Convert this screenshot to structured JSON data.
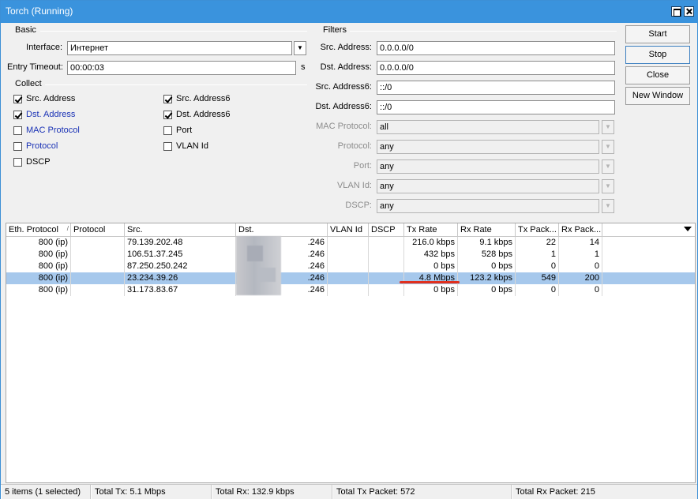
{
  "window": {
    "title": "Torch (Running)"
  },
  "basic": {
    "section": "Basic",
    "interface_label": "Interface:",
    "interface_value": "Интернет",
    "timeout_label": "Entry Timeout:",
    "timeout_value": "00:00:03",
    "timeout_unit": "s"
  },
  "collect": {
    "section": "Collect",
    "items": [
      {
        "label": "Src. Address",
        "checked": true
      },
      {
        "label": "Src. Address6",
        "checked": true
      },
      {
        "label": "Dst. Address",
        "checked": true
      },
      {
        "label": "Dst. Address6",
        "checked": true
      },
      {
        "label": "MAC Protocol",
        "checked": false
      },
      {
        "label": "Port",
        "checked": false
      },
      {
        "label": "Protocol",
        "checked": false
      },
      {
        "label": "VLAN Id",
        "checked": false
      },
      {
        "label": "DSCP",
        "checked": false
      }
    ]
  },
  "filters": {
    "section": "Filters",
    "src_address_label": "Src. Address:",
    "src_address_value": "0.0.0.0/0",
    "dst_address_label": "Dst. Address:",
    "dst_address_value": "0.0.0.0/0",
    "src_address6_label": "Src. Address6:",
    "src_address6_value": "::/0",
    "dst_address6_label": "Dst. Address6:",
    "dst_address6_value": "::/0",
    "mac_protocol_label": "MAC Protocol:",
    "mac_protocol_value": "all",
    "protocol_label": "Protocol:",
    "protocol_value": "any",
    "port_label": "Port:",
    "port_value": "any",
    "vlan_label": "VLAN Id:",
    "vlan_value": "any",
    "dscp_label": "DSCP:",
    "dscp_value": "any"
  },
  "buttons": {
    "start": "Start",
    "stop": "Stop",
    "close": "Close",
    "new_window": "New Window"
  },
  "table": {
    "columns": [
      "Eth. Protocol",
      "Protocol",
      "Src.",
      "Dst.",
      "VLAN Id",
      "DSCP",
      "Tx Rate",
      "Rx Rate",
      "Tx Pack...",
      "Rx Pack..."
    ],
    "rows": [
      {
        "eth": "800 (ip)",
        "proto": "",
        "src": "79.139.202.48",
        "dst": ".246",
        "vlan": "",
        "dscp": "",
        "tx": "216.0 kbps",
        "rx": "9.1 kbps",
        "txp": "22",
        "rxp": "14",
        "selected": false
      },
      {
        "eth": "800 (ip)",
        "proto": "",
        "src": "106.51.37.245",
        "dst": ".246",
        "vlan": "",
        "dscp": "",
        "tx": "432 bps",
        "rx": "528 bps",
        "txp": "1",
        "rxp": "1",
        "selected": false
      },
      {
        "eth": "800 (ip)",
        "proto": "",
        "src": "87.250.250.242",
        "dst": ".246",
        "vlan": "",
        "dscp": "",
        "tx": "0 bps",
        "rx": "0 bps",
        "txp": "0",
        "rxp": "0",
        "selected": false
      },
      {
        "eth": "800 (ip)",
        "proto": "",
        "src": "23.234.39.26",
        "dst": ".246",
        "vlan": "",
        "dscp": "",
        "tx": "4.8 Mbps",
        "rx": "123.2 kbps",
        "txp": "549",
        "rxp": "200",
        "selected": true
      },
      {
        "eth": "800 (ip)",
        "proto": "",
        "src": "31.173.83.67",
        "dst": ".246",
        "vlan": "",
        "dscp": "",
        "tx": "0 bps",
        "rx": "0 bps",
        "txp": "0",
        "rxp": "0",
        "selected": false
      }
    ]
  },
  "status": {
    "items": "5 items (1 selected)",
    "total_tx": "Total Tx: 5.1 Mbps",
    "total_rx": "Total Rx: 132.9 kbps",
    "total_tx_packet": "Total Tx Packet: 572",
    "total_rx_packet": "Total Rx Packet: 215"
  },
  "colors": {
    "titlebar": "#3a93dd",
    "selection": "#a6c8ec",
    "highlight_underline": "#e0301e",
    "link_blue": "#1a32b5"
  }
}
